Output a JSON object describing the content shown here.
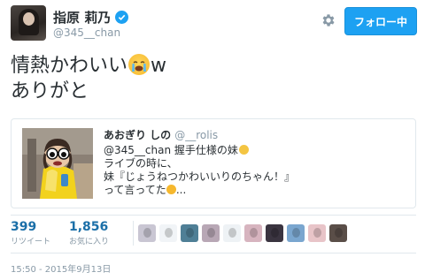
{
  "user": {
    "name": "指原 莉乃",
    "handle": "@345__chan"
  },
  "follow_button_label": "フォロー中",
  "tweet": {
    "line1_before": "情熱かわいい",
    "line1_emoji": "loudly-crying-face-emoji",
    "line1_after": "w",
    "line2": "ありがと"
  },
  "quoted": {
    "name": "あおぎり しの",
    "handle": "@__rolis",
    "lines": [
      "@345__chan 握手仕様の妹",
      "ライブの時に、",
      "妹『じょうねつかわいいりのちゃん！』",
      "って言ってた"
    ],
    "line4_suffix": "..."
  },
  "stats": {
    "retweets": "399",
    "retweets_label": "リツイート",
    "likes": "1,856",
    "likes_label": "お気に入り"
  },
  "likers_colors": [
    "#c9c6d3",
    "#f1f4f7",
    "#4f7f96",
    "#b8a7b5",
    "#eef2f5",
    "#d7b4bf",
    "#3a3440",
    "#7aa6cf",
    "#e8c4c8",
    "#5a4e48"
  ],
  "timestamp": "15:50 - 2015年9月13日",
  "colors": {
    "accent": "#1da1f2",
    "link": "#1b6fa8",
    "muted": "#8899a6",
    "border": "#e1e8ed"
  }
}
